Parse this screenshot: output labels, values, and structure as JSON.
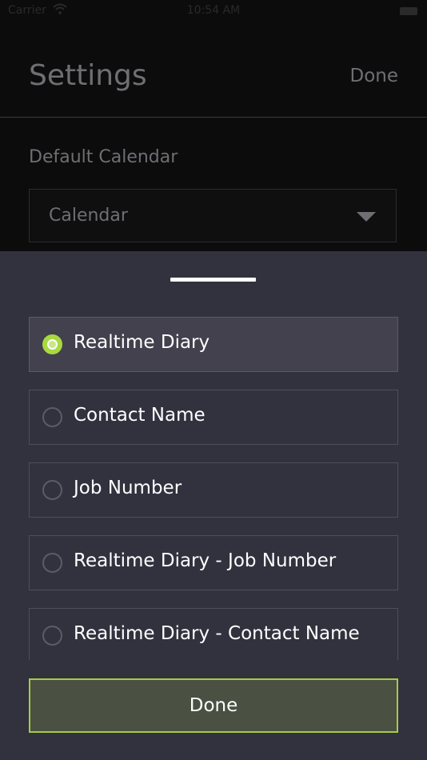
{
  "status_bar": {
    "carrier": "Carrier",
    "time": "10:54 AM"
  },
  "header": {
    "title": "Settings",
    "done_label": "Done"
  },
  "default_calendar": {
    "label": "Default Calendar",
    "value": "Calendar"
  },
  "sheet": {
    "options": [
      {
        "label": "Realtime Diary",
        "selected": true
      },
      {
        "label": "Contact Name",
        "selected": false
      },
      {
        "label": "Job Number",
        "selected": false
      },
      {
        "label": "Realtime Diary - Job Number",
        "selected": false
      },
      {
        "label": "Realtime Diary - Contact Name",
        "selected": false
      }
    ],
    "done_label": "Done"
  },
  "colors": {
    "accent": "#a8d93e",
    "sheet_background": "#32313e",
    "done_background": "#4a5042"
  }
}
